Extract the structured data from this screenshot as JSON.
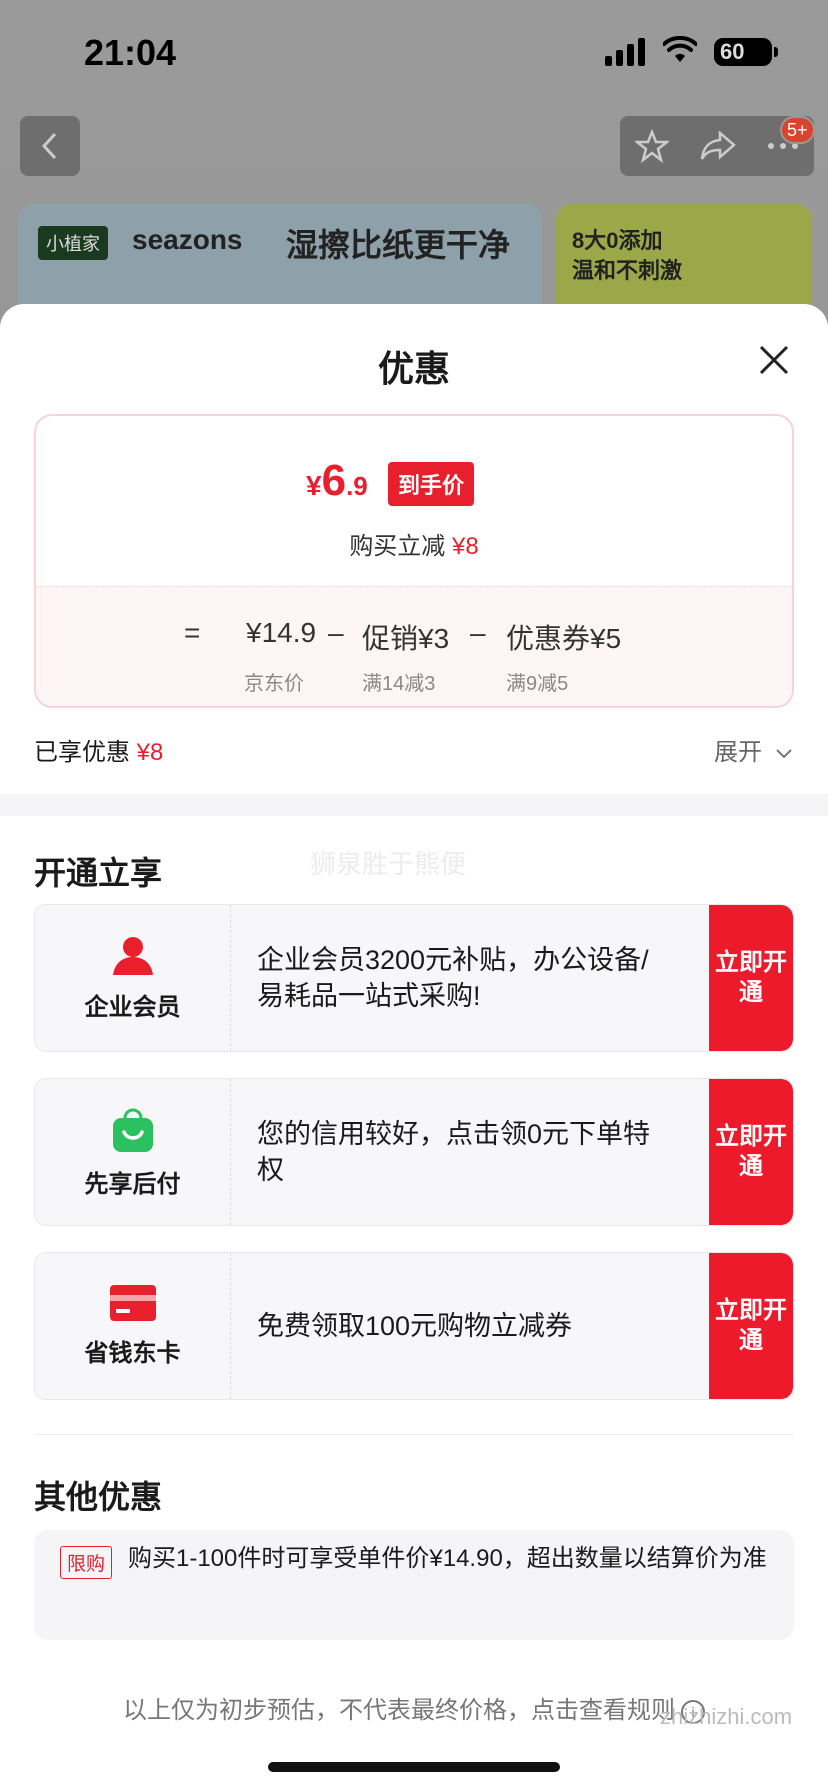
{
  "status": {
    "time": "21:04",
    "battery": "60"
  },
  "nav": {
    "badge": "5+"
  },
  "banner": {
    "brand_box": "小植家",
    "brand": "seazons",
    "slogan": "湿擦比纸更干净",
    "side_line1": "8大0添加",
    "side_line2": "温和不刺激"
  },
  "sheet": {
    "title": "优惠",
    "price": {
      "yen": "¥",
      "int": "6",
      "dec": ".9",
      "tag": "到手价",
      "minus_label": "购买立减",
      "minus_value": "¥8"
    },
    "formula": {
      "eq": "=",
      "base": "¥14.9",
      "base_label": "京东价",
      "op1": "–",
      "promo": "促销¥3",
      "promo_label": "满14减3",
      "op2": "–",
      "coupon": "优惠券¥5",
      "coupon_label": "满9减5"
    },
    "enjoyed_label": "已享优惠",
    "enjoyed_value": "¥8",
    "expand": "展开",
    "open_title": "开通立享",
    "watermark": "狮泉胜于熊便",
    "offers": [
      {
        "name": "企业会员",
        "text": "企业会员3200元补贴，办公设备/易耗品一站式采购!",
        "button": "立即开通"
      },
      {
        "name": "先享后付",
        "text": "您的信用较好，点击领0元下单特权",
        "button": "立即开通"
      },
      {
        "name": "省钱东卡",
        "text": "免费领取100元购物立减券",
        "button": "立即开通"
      }
    ],
    "other_title": "其他优惠",
    "other": {
      "tag": "限购",
      "text": "购买1-100件时可享受单件价¥14.90，超出数量以结算价为准"
    },
    "footer": "以上仅为初步预估，不代表最终价格，点击查看规则",
    "site_watermark": "zhizhizhi.com"
  },
  "colors": {
    "accent": "#e8202e",
    "button": "#ec1a2a",
    "green": "#2cc160"
  }
}
